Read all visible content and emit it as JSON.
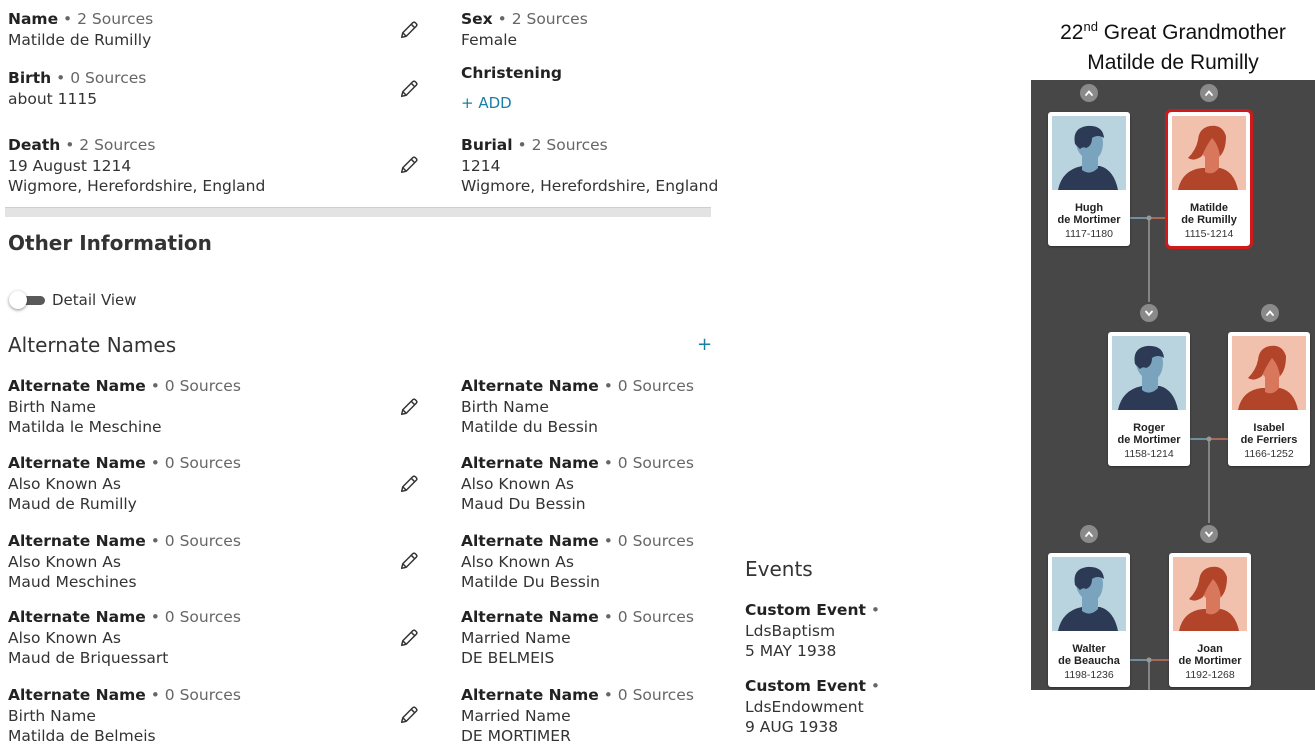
{
  "vitals": {
    "name": {
      "label": "Name",
      "sources": "• 2 Sources",
      "value": "Matilde de Rumilly"
    },
    "sex": {
      "label": "Sex",
      "sources": "• 2 Sources",
      "value": "Female"
    },
    "birth": {
      "label": "Birth",
      "sources": "• 0 Sources",
      "value": "about 1115"
    },
    "christening": {
      "label": "Christening",
      "add": "+  ADD"
    },
    "death": {
      "label": "Death",
      "sources": "• 2 Sources",
      "date": "19 August 1214",
      "place": "Wigmore, Herefordshire, England"
    },
    "burial": {
      "label": "Burial",
      "sources": "• 2 Sources",
      "date": "1214",
      "place": "Wigmore, Herefordshire, England"
    }
  },
  "other_info": {
    "heading": "Other Information",
    "detail_view_label": "Detail View",
    "detail_view_on": false
  },
  "alternate_names": {
    "heading": "Alternate Names",
    "add": "+",
    "items": [
      {
        "label": "Alternate Name",
        "sources": "• 0 Sources",
        "type": "Birth Name",
        "value": "Matilda le Meschine"
      },
      {
        "label": "Alternate Name",
        "sources": "• 0 Sources",
        "type": "Birth Name",
        "value": "Matilde du Bessin"
      },
      {
        "label": "Alternate Name",
        "sources": "• 0 Sources",
        "type": "Also Known As",
        "value": "Maud de Rumilly"
      },
      {
        "label": "Alternate Name",
        "sources": "• 0 Sources",
        "type": "Also Known As",
        "value": "Maud Du Bessin"
      },
      {
        "label": "Alternate Name",
        "sources": "• 0 Sources",
        "type": "Also Known As",
        "value": "Maud Meschines"
      },
      {
        "label": "Alternate Name",
        "sources": "• 0 Sources",
        "type": "Also Known As",
        "value": "Matilde Du Bessin"
      },
      {
        "label": "Alternate Name",
        "sources": "• 0 Sources",
        "type": "Also Known As",
        "value": "Maud de Briquessart"
      },
      {
        "label": "Alternate Name",
        "sources": "• 0 Sources",
        "type": "Married Name",
        "value": "DE BELMEIS"
      },
      {
        "label": "Alternate Name",
        "sources": "• 0 Sources",
        "type": "Birth Name",
        "value": "Matilda de Belmeis"
      },
      {
        "label": "Alternate Name",
        "sources": "• 0 Sources",
        "type": "Married Name",
        "value": "DE MORTIMER"
      }
    ]
  },
  "events": {
    "heading": "Events",
    "items": [
      {
        "label": "Custom Event",
        "sep": " •",
        "type": "LdsBaptism",
        "date": "5 MAY 1938"
      },
      {
        "label": "Custom Event",
        "sep": " •",
        "type": "LdsEndowment",
        "date": "9 AUG 1938"
      }
    ]
  },
  "relationship": {
    "ordinal_num": "22",
    "ordinal_suffix": "nd",
    "relation": " Great Grandmother",
    "name": "Matilde de Rumilly"
  },
  "tree": {
    "people": [
      {
        "first": "Hugh",
        "last": "de Mortimer",
        "dates": "1117-1180",
        "gender": "male",
        "selected": false
      },
      {
        "first": "Matilde",
        "last": "de Rumilly",
        "dates": "1115-1214",
        "gender": "female",
        "selected": true
      },
      {
        "first": "Roger",
        "last": "de Mortimer",
        "dates": "1158-1214",
        "gender": "male",
        "selected": false
      },
      {
        "first": "Isabel",
        "last": "de Ferriers",
        "dates": "1166-1252",
        "gender": "female",
        "selected": false
      },
      {
        "first": "Walter",
        "last": "de Beaucha",
        "dates": "1198-1236",
        "gender": "male",
        "selected": false
      },
      {
        "first": "Joan",
        "last": "de Mortimer",
        "dates": "1192-1268",
        "gender": "female",
        "selected": false
      }
    ]
  },
  "colors": {
    "male_bg": "#b9d4df",
    "male_hair": "#2d3a55",
    "male_skin": "#7aa3bd",
    "female_bg": "#f2c1ad",
    "female_hair": "#b2442a",
    "female_skin": "#d9775c",
    "selected_border": "#d01a1a",
    "tree_bg": "#474747",
    "link": "#1a7fa5"
  }
}
